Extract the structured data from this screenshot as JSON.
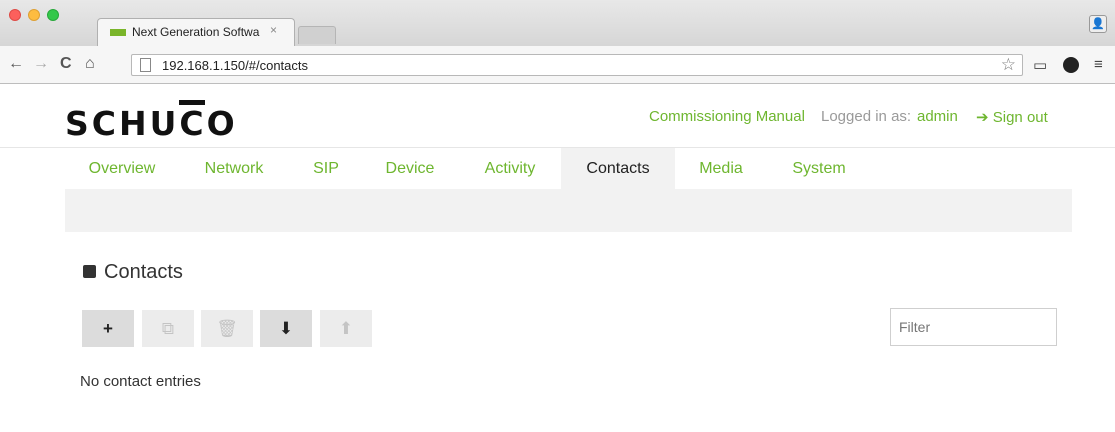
{
  "browser": {
    "tab_title": "Next Generation Software",
    "tab_close": "×",
    "url": "192.168.1.150/#/contacts",
    "icons": [
      "back-icon",
      "forward-icon",
      "reload-icon",
      "home-icon",
      "star-icon",
      "cast-icon",
      "extension-icon",
      "menu-icon",
      "profile-icon"
    ]
  },
  "header": {
    "logo": "SCHUCO",
    "manual_link": "Commissioning Manual",
    "logged_in_label": "Logged in as:",
    "username": "admin",
    "sign_out": "Sign out"
  },
  "nav": {
    "tabs": [
      "Overview",
      "Network",
      "SIP",
      "Device",
      "Activity",
      "Contacts",
      "Media",
      "System"
    ],
    "active": "Contacts"
  },
  "contacts": {
    "title": "Contacts",
    "toolbar": {
      "add": "+",
      "copy": "⧉",
      "delete": "🗑",
      "download": "⬇",
      "upload": "⬆"
    },
    "filter_placeholder": "Filter",
    "empty_message": "No contact entries"
  },
  "colors": {
    "accent": "#6eb62f",
    "text": "#333333",
    "band": "#f2f2f2"
  }
}
